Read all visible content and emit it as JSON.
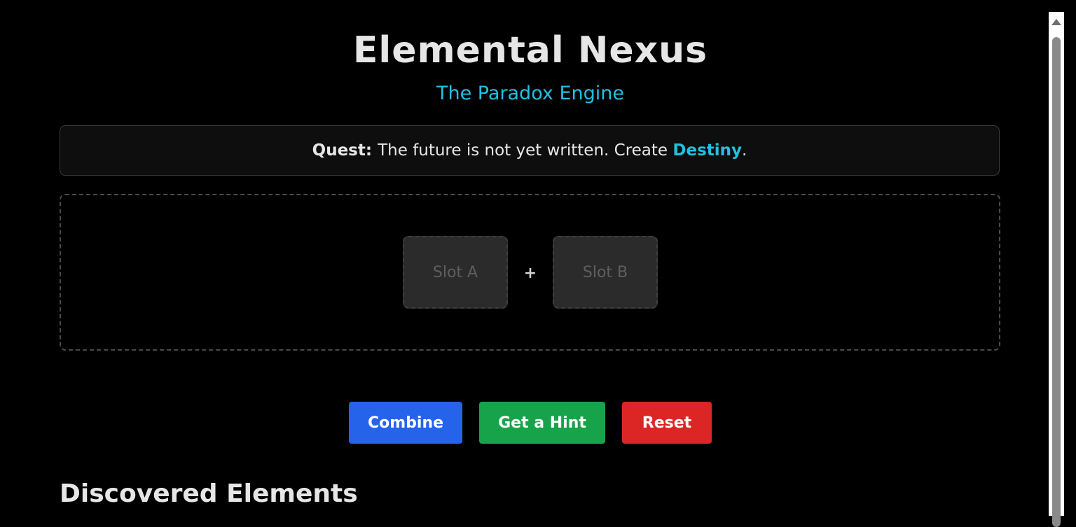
{
  "header": {
    "title": "Elemental Nexus",
    "subtitle": "The Paradox Engine"
  },
  "quest": {
    "label": "Quest:",
    "text": "The future is not yet written. Create ",
    "target": "Destiny",
    "suffix": "."
  },
  "workspace": {
    "slot_a": "Slot A",
    "operator": "+",
    "slot_b": "Slot B"
  },
  "actions": {
    "combine": "Combine",
    "hint": "Get a Hint",
    "reset": "Reset"
  },
  "discovered": {
    "heading": "Discovered Elements"
  },
  "colors": {
    "accent": "#22c0e0",
    "combine": "#2563eb",
    "hint": "#16a34a",
    "reset": "#dc2626"
  }
}
